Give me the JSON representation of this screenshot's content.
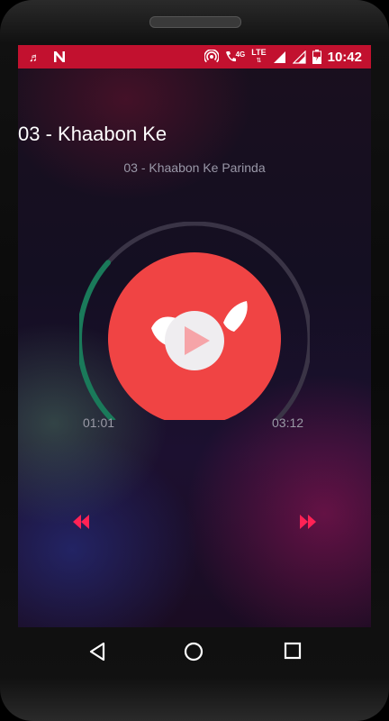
{
  "status_bar": {
    "time": "10:42",
    "network_4g": "4G",
    "network_lte": "LTE",
    "icons": [
      "music-note-icon",
      "n-notification-icon",
      "hotspot-icon",
      "wifi-calling-icon",
      "signal-icon",
      "signal-icon",
      "battery-charging-icon"
    ],
    "color": "#c2112f"
  },
  "player": {
    "title": "03 - Khaabon Ke",
    "subtitle": "03 - Khaabon Ke Parinda",
    "elapsed": "01:01",
    "total": "03:12",
    "progress_fraction": 0.32,
    "accent_color": "#f04444",
    "progress_color": "#1a7a5a"
  },
  "controls": {
    "prev_icon": "rewind-icon",
    "next_icon": "fast-forward-icon",
    "play_icon": "play-icon",
    "color": "#ff2255"
  },
  "navigation": {
    "back_icon": "back-triangle-icon",
    "home_icon": "home-circle-icon",
    "recents_icon": "recents-square-icon"
  }
}
